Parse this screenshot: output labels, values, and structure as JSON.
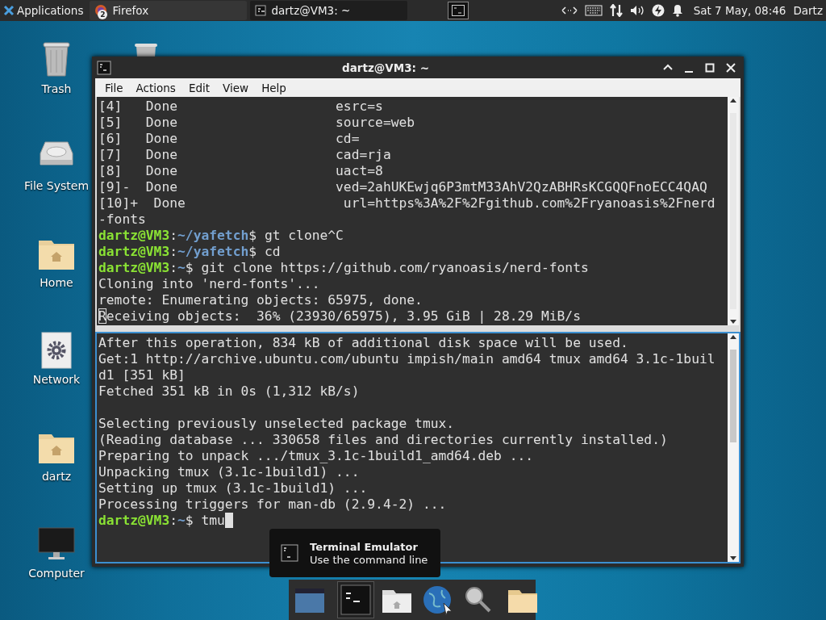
{
  "top_panel": {
    "menu": {
      "label": "Applications"
    },
    "tasks": [
      {
        "label": "Firefox",
        "badge": "2",
        "kind": "browser",
        "selected": false
      },
      {
        "label": "dartz@VM3: ~",
        "kind": "terminal",
        "selected": true
      }
    ],
    "clock": "Sat 7 May, 08:46",
    "user": "Dartz"
  },
  "desktop_icons": [
    {
      "label": "Trash",
      "kind": "trash"
    },
    {
      "label": "File System",
      "kind": "drive"
    },
    {
      "label": "Home",
      "kind": "home"
    },
    {
      "label": "Network",
      "kind": "network"
    },
    {
      "label": "dartz",
      "kind": "home"
    },
    {
      "label": "Computer",
      "kind": "computer"
    }
  ],
  "terminal": {
    "title": "dartz@VM3: ~",
    "menu": [
      "File",
      "Actions",
      "Edit",
      "View",
      "Help"
    ],
    "panes": [
      {
        "focused": false,
        "lines": [
          {
            "kind": "output",
            "text": "[4]   Done                    esrc=s"
          },
          {
            "kind": "output",
            "text": "[5]   Done                    source=web"
          },
          {
            "kind": "output",
            "text": "[6]   Done                    cd="
          },
          {
            "kind": "output",
            "text": "[7]   Done                    cad=rja"
          },
          {
            "kind": "output",
            "text": "[8]   Done                    uact=8"
          },
          {
            "kind": "output",
            "text": "[9]-  Done                    ved=2ahUKEwjq6P3mtM33AhV2QzABHRsKCGQQFnoECC4QAQ"
          },
          {
            "kind": "output",
            "text": "[10]+  Done                    url=https%3A%2F%2Fgithub.com%2Fryanoasis%2Fnerd"
          },
          {
            "kind": "output",
            "text": "-fonts"
          },
          {
            "kind": "prompt",
            "segments": [
              {
                "kind": "user",
                "text": "dartz@VM3"
              },
              {
                "kind": "plain",
                "text": ":"
              },
              {
                "kind": "path",
                "text": "~/yafetch"
              },
              {
                "kind": "plain",
                "text": "$ gt clone^C"
              }
            ]
          },
          {
            "kind": "prompt",
            "segments": [
              {
                "kind": "user",
                "text": "dartz@VM3"
              },
              {
                "kind": "plain",
                "text": ":"
              },
              {
                "kind": "path",
                "text": "~/yafetch"
              },
              {
                "kind": "plain",
                "text": "$ cd"
              }
            ]
          },
          {
            "kind": "prompt",
            "segments": [
              {
                "kind": "user",
                "text": "dartz@VM3"
              },
              {
                "kind": "plain",
                "text": ":"
              },
              {
                "kind": "path",
                "text": "~"
              },
              {
                "kind": "plain",
                "text": "$ git clone https://github.com/ryanoasis/nerd-fonts"
              }
            ]
          },
          {
            "kind": "output",
            "text": "Cloning into 'nerd-fonts'..."
          },
          {
            "kind": "output",
            "text": "remote: Enumerating objects: 65975, done."
          },
          {
            "kind": "output",
            "text": "Receiving objects:  36% (23930/65975), 3.95 GiB | 28.29 MiB/s"
          }
        ]
      },
      {
        "focused": true,
        "lines": [
          {
            "kind": "output",
            "text": "After this operation, 834 kB of additional disk space will be used."
          },
          {
            "kind": "output",
            "text": "Get:1 http://archive.ubuntu.com/ubuntu impish/main amd64 tmux amd64 3.1c-1buil"
          },
          {
            "kind": "output",
            "text": "d1 [351 kB]"
          },
          {
            "kind": "output",
            "text": "Fetched 351 kB in 0s (1,312 kB/s)"
          },
          {
            "kind": "blank"
          },
          {
            "kind": "output",
            "text": "Selecting previously unselected package tmux."
          },
          {
            "kind": "output",
            "text": "(Reading database ... 330658 files and directories currently installed.)"
          },
          {
            "kind": "output",
            "text": "Preparing to unpack .../tmux_3.1c-1build1_amd64.deb ..."
          },
          {
            "kind": "output",
            "text": "Unpacking tmux (3.1c-1build1) ..."
          },
          {
            "kind": "output",
            "text": "Setting up tmux (3.1c-1build1) ..."
          },
          {
            "kind": "output",
            "text": "Processing triggers for man-db (2.9.4-2) ..."
          },
          {
            "kind": "prompt",
            "segments": [
              {
                "kind": "user",
                "text": "dartz@VM3"
              },
              {
                "kind": "plain",
                "text": ":"
              },
              {
                "kind": "path",
                "text": "~"
              },
              {
                "kind": "plain",
                "text": "$ tmu"
              }
            ]
          }
        ]
      }
    ]
  },
  "tooltip": {
    "title": "Terminal Emulator",
    "subtitle": "Use the command line"
  }
}
